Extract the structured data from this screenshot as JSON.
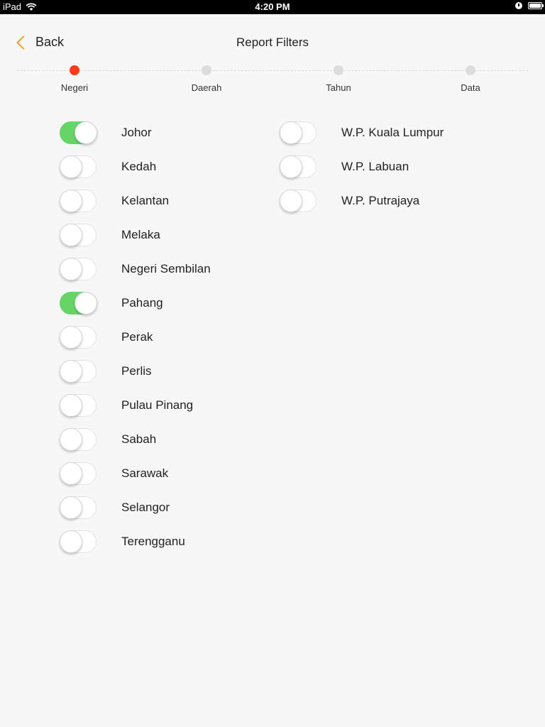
{
  "status_bar": {
    "carrier": "iPad",
    "time": "4:20 PM"
  },
  "nav": {
    "back_label": "Back",
    "title": "Report Filters"
  },
  "steps": [
    {
      "label": "Negeri",
      "active": true
    },
    {
      "label": "Daerah",
      "active": false
    },
    {
      "label": "Tahun",
      "active": false
    },
    {
      "label": "Data",
      "active": false
    }
  ],
  "states_left": [
    {
      "name": "Johor",
      "on": true
    },
    {
      "name": "Kedah",
      "on": false
    },
    {
      "name": "Kelantan",
      "on": false
    },
    {
      "name": "Melaka",
      "on": false
    },
    {
      "name": "Negeri Sembilan",
      "on": false
    },
    {
      "name": "Pahang",
      "on": true
    },
    {
      "name": "Perak",
      "on": false
    },
    {
      "name": "Perlis",
      "on": false
    },
    {
      "name": "Pulau Pinang",
      "on": false
    },
    {
      "name": "Sabah",
      "on": false
    },
    {
      "name": "Sarawak",
      "on": false
    },
    {
      "name": "Selangor",
      "on": false
    },
    {
      "name": "Terengganu",
      "on": false
    }
  ],
  "states_right": [
    {
      "name": "W.P. Kuala Lumpur",
      "on": false
    },
    {
      "name": "W.P. Labuan",
      "on": false
    },
    {
      "name": "W.P. Putrajaya",
      "on": false
    }
  ],
  "colors": {
    "accent": "#f0a020",
    "active_step": "#ff3b1a",
    "toggle_on": "#65d566"
  },
  "icons": [
    "wifi-icon",
    "lock-rotation-icon",
    "battery-icon",
    "chevron-left-icon"
  ]
}
